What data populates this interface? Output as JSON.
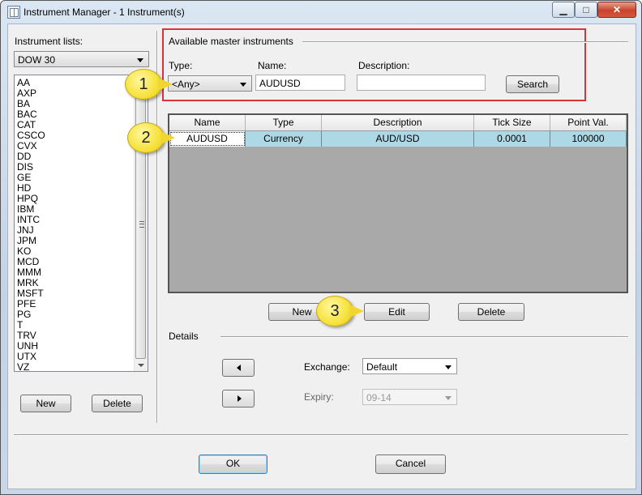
{
  "window": {
    "title": "Instrument Manager - 1 Instrument(s)",
    "controls": {
      "minimize": "▁",
      "maximize": "□",
      "close": "✕"
    }
  },
  "left_panel": {
    "instrument_lists_label": "Instrument lists:",
    "selected_list": "DOW 30",
    "instruments": [
      "AA",
      "AXP",
      "BA",
      "BAC",
      "CAT",
      "CSCO",
      "CVX",
      "DD",
      "DIS",
      "GE",
      "HD",
      "HPQ",
      "IBM",
      "INTC",
      "JNJ",
      "JPM",
      "KO",
      "MCD",
      "MMM",
      "MRK",
      "MSFT",
      "PFE",
      "PG",
      "T",
      "TRV",
      "UNH",
      "UTX",
      "VZ"
    ],
    "new_button": "New",
    "delete_button": "Delete"
  },
  "master": {
    "group_label": "Available master instruments",
    "type_label": "Type:",
    "type_value": "<Any>",
    "name_label": "Name:",
    "name_value": "AUDUSD",
    "description_label": "Description:",
    "description_value": "",
    "search_button": "Search"
  },
  "grid": {
    "columns": [
      "Name",
      "Type",
      "Description",
      "Tick Size",
      "Point Val."
    ],
    "rows": [
      [
        "AUDUSD",
        "Currency",
        "AUD/USD",
        "0.0001",
        "100000"
      ]
    ]
  },
  "grid_buttons": {
    "new": "New",
    "edit": "Edit",
    "delete": "Delete"
  },
  "details": {
    "label": "Details",
    "exchange_label": "Exchange:",
    "exchange_value": "Default",
    "expiry_label": "Expiry:",
    "expiry_value": "09-14"
  },
  "callouts": [
    "1",
    "2",
    "3"
  ],
  "footer": {
    "ok": "OK",
    "cancel": "Cancel"
  },
  "colors": {
    "annotation_box": "#d9343b",
    "selected_row": "#add8e6",
    "callout": "#f6e23b"
  }
}
